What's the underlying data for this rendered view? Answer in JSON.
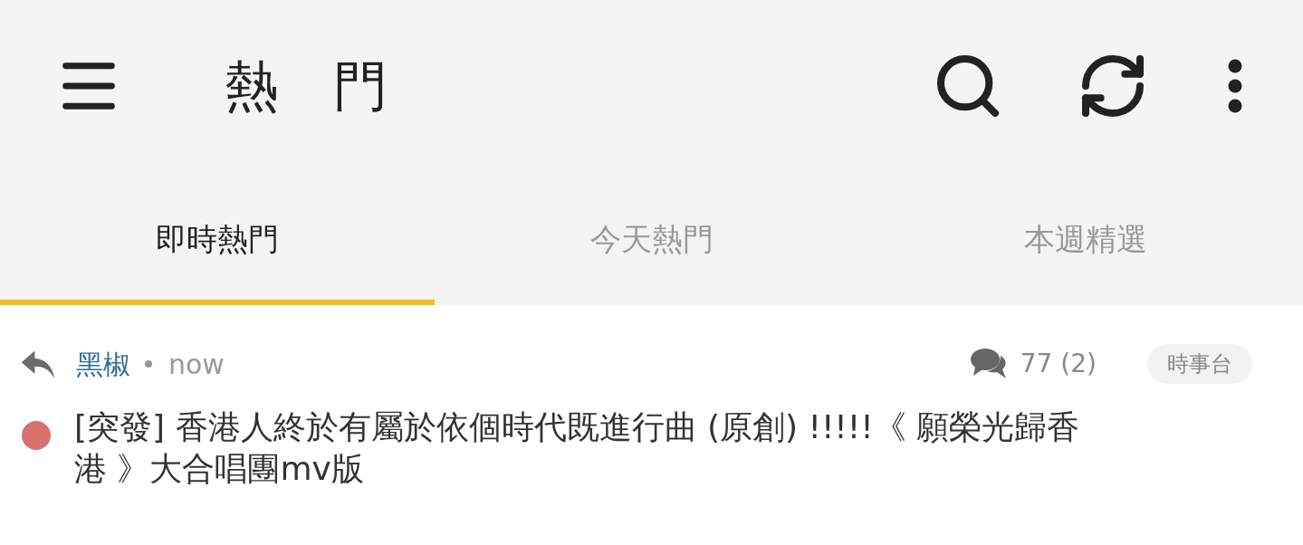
{
  "app_bar": {
    "title": "熱　門"
  },
  "tabs": [
    {
      "label": "即時熱門",
      "selected": true
    },
    {
      "label": "今天熱門",
      "selected": false
    },
    {
      "label": "本週精選",
      "selected": false
    }
  ],
  "posts": [
    {
      "author": "黑椒",
      "time": "now",
      "comments": "77 (2)",
      "category": "時事台",
      "color": "#d97070",
      "title": "[突發] 香港人終於有屬於依個時代既進行曲 (原創) !!!!!《 願榮光歸香港 》大合唱團mv版"
    }
  ]
}
